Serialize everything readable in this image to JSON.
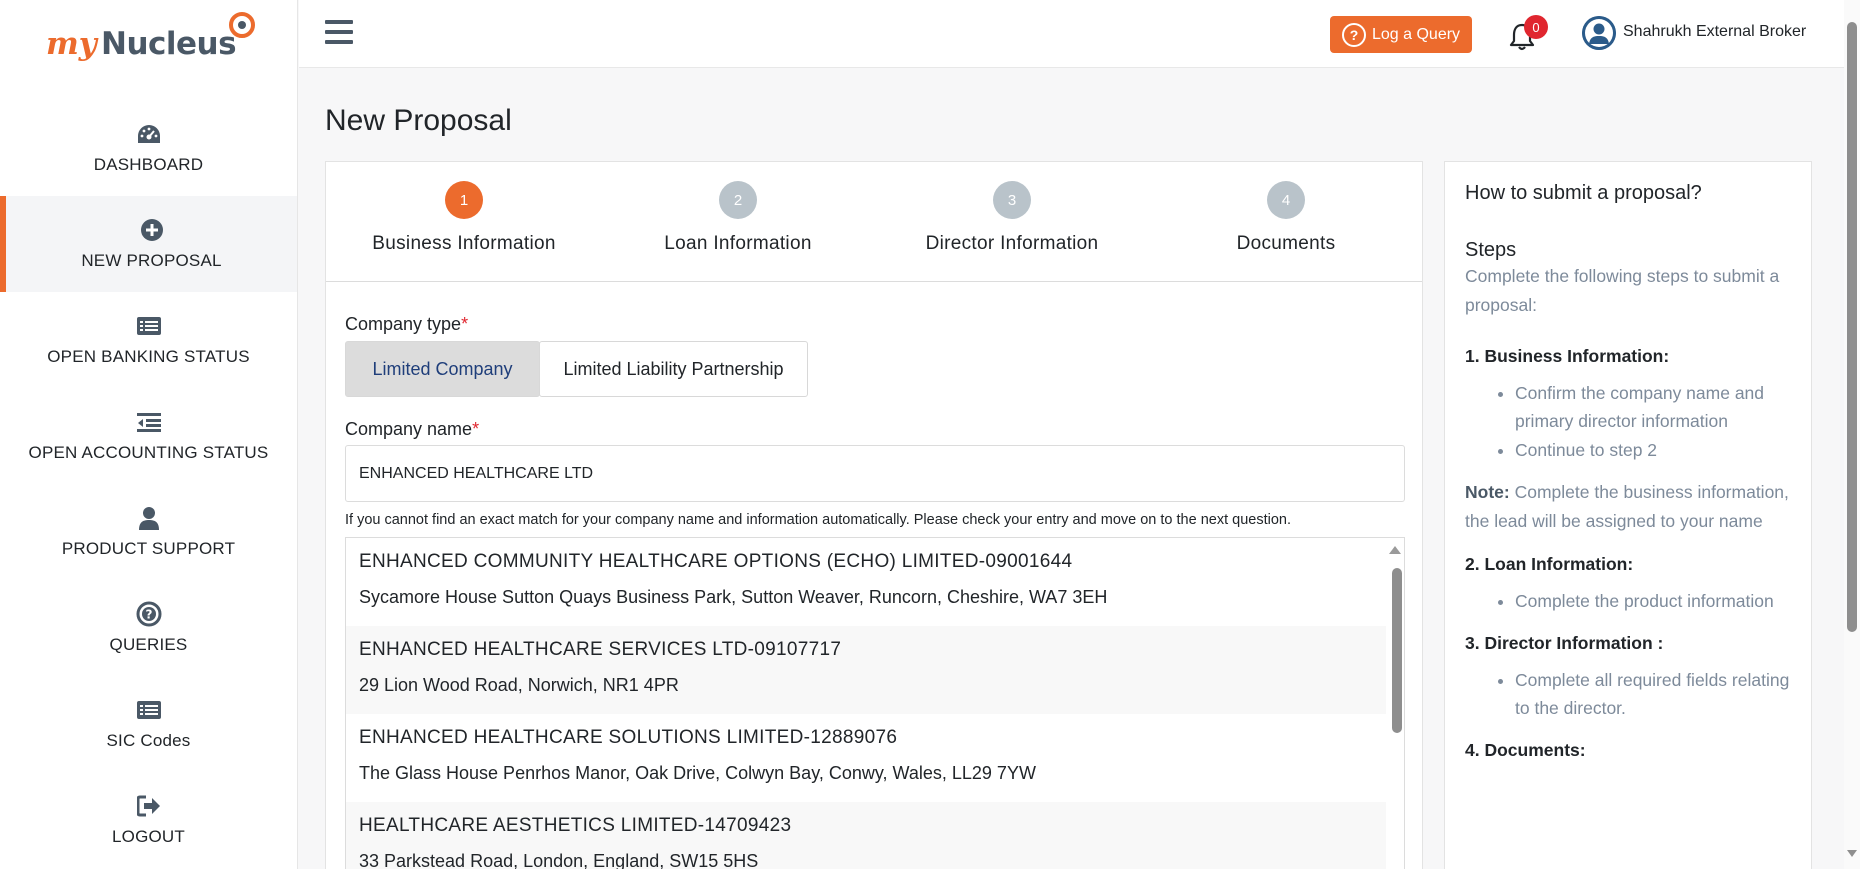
{
  "app": {
    "logo_my": "my",
    "logo_nucleus": "Nucleus",
    "accent_color": "#ec6b2d"
  },
  "sidebar": {
    "items": [
      {
        "label": "DASHBOARD",
        "icon": "dashboard-gauge-icon"
      },
      {
        "label": "NEW PROPOSAL",
        "icon": "plus-circle-icon",
        "active": true
      },
      {
        "label": "OPEN BANKING STATUS",
        "icon": "list-card-icon"
      },
      {
        "label": "OPEN ACCOUNTING STATUS",
        "icon": "outdent-list-icon"
      },
      {
        "label": "PRODUCT SUPPORT",
        "icon": "user-icon"
      },
      {
        "label": "QUERIES",
        "icon": "question-circle-icon"
      },
      {
        "label": "SIC Codes",
        "icon": "list-card-icon"
      },
      {
        "label": "LOGOUT",
        "icon": "sign-out-icon"
      }
    ]
  },
  "topbar": {
    "log_query_label": "Log a Query",
    "notification_count": "0",
    "user_name": "Shahrukh External Broker"
  },
  "page": {
    "title": "New Proposal"
  },
  "steps": [
    {
      "number": "1",
      "label": "Business Information",
      "active": true
    },
    {
      "number": "2",
      "label": "Loan Information"
    },
    {
      "number": "3",
      "label": "Director Information"
    },
    {
      "number": "4",
      "label": "Documents"
    }
  ],
  "form": {
    "company_type_label": "Company type",
    "required_mark": "*",
    "company_type_options": [
      "Limited Company",
      "Limited Liability Partnership"
    ],
    "company_type_selected": "Limited Company",
    "company_name_label": "Company name",
    "company_name_value": "ENHANCED HEALTHCARE LTD",
    "help_text": "If you cannot find an exact match for your company name and information automatically. Please check your entry and move on to the next question."
  },
  "results": [
    {
      "name": "ENHANCED COMMUNITY HEALTHCARE OPTIONS (ECHO) LIMITED-09001644",
      "address": "Sycamore House Sutton Quays Business Park, Sutton Weaver, Runcorn, Cheshire, WA7 3EH"
    },
    {
      "name": "ENHANCED HEALTHCARE SERVICES LTD-09107717",
      "address": "29 Lion Wood Road, Norwich, NR1 4PR"
    },
    {
      "name": "ENHANCED HEALTHCARE SOLUTIONS LIMITED-12889076",
      "address": "The Glass House Penrhos Manor, Oak Drive, Colwyn Bay, Conwy, Wales, LL29 7YW"
    },
    {
      "name": "HEALTHCARE AESTHETICS LIMITED-14709423",
      "address": "33 Parkstead Road, London, England, SW15 5HS"
    }
  ],
  "help": {
    "title": "How to submit a proposal?",
    "steps_heading": "Steps",
    "intro": "Complete the following steps to submit a proposal:",
    "section1_title": "1. Business Information:",
    "section1_items": [
      "Confirm the company name and primary director information",
      "Continue to step 2"
    ],
    "note_label": "Note:",
    "note_text": " Complete the business information, the lead will be assigned to your name",
    "section2_title": "2. Loan Information:",
    "section2_items": [
      "Complete the product information"
    ],
    "section3_title": "3. Director Information :",
    "section3_items": [
      "Complete all required fields relating to the director."
    ],
    "section4_title": "4. Documents:"
  }
}
